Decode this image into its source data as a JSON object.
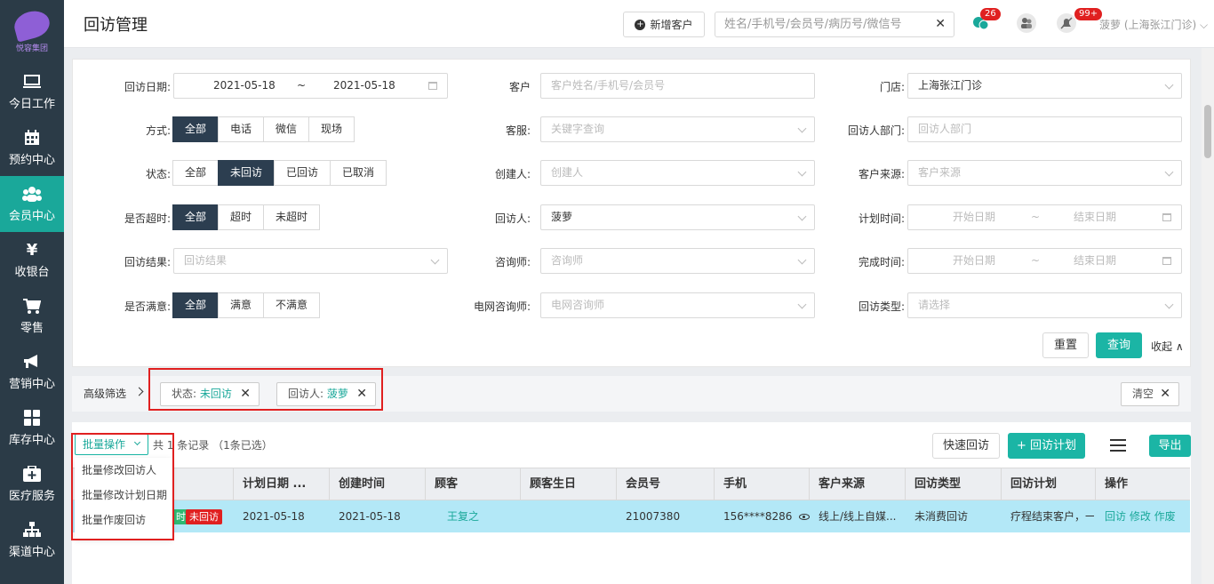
{
  "app": {
    "logo_text": "悦容集团",
    "title": "回访管理"
  },
  "sidebar": {
    "items": [
      {
        "label": "今日工作",
        "icon": "monitor-icon"
      },
      {
        "label": "预约中心",
        "icon": "calendar-icon"
      },
      {
        "label": "会员中心",
        "icon": "members-icon",
        "active": true
      },
      {
        "label": "收银台",
        "icon": "yen-icon"
      },
      {
        "label": "零售",
        "icon": "cart-icon"
      },
      {
        "label": "营销中心",
        "icon": "megaphone-icon"
      },
      {
        "label": "库存中心",
        "icon": "grid-icon"
      },
      {
        "label": "医疗服务",
        "icon": "medical-kit-icon"
      },
      {
        "label": "渠道中心",
        "icon": "org-chart-icon"
      }
    ]
  },
  "topbar": {
    "new_customer": "新增客户",
    "search_placeholder": "姓名/手机号/会员号/病历号/微信号",
    "chat_badge": "26",
    "notify_badge": "99+",
    "user": "菠萝 (上海张江门诊)"
  },
  "filters": {
    "visit_date": {
      "label": "回访日期:",
      "start": "2021-05-18",
      "sep": "~",
      "end": "2021-05-18"
    },
    "customer": {
      "label": "客户",
      "placeholder": "客户姓名/手机号/会员号"
    },
    "store": {
      "label": "门店:",
      "value": "上海张江门诊"
    },
    "method": {
      "label": "方式:",
      "options": [
        "全部",
        "电话",
        "微信",
        "现场"
      ]
    },
    "service": {
      "label": "客服:",
      "placeholder": "关键字查询"
    },
    "dept": {
      "label": "回访人部门:",
      "placeholder": "回访人部门"
    },
    "status": {
      "label": "状态:",
      "options": [
        "全部",
        "未回访",
        "已回访",
        "已取消"
      ]
    },
    "creator": {
      "label": "创建人:",
      "placeholder": "创建人"
    },
    "source": {
      "label": "客户来源:",
      "placeholder": "客户来源"
    },
    "overtime": {
      "label": "是否超时:",
      "options": [
        "全部",
        "超时",
        "未超时"
      ]
    },
    "visitor": {
      "label": "回访人:",
      "value": "菠萝"
    },
    "plan_time": {
      "label": "计划时间:",
      "start": "开始日期",
      "sep": "~",
      "end": "结束日期"
    },
    "result": {
      "label": "回访结果:",
      "placeholder": "回访结果"
    },
    "consultant": {
      "label": "咨询师:",
      "placeholder": "咨询师"
    },
    "done_time": {
      "label": "完成时间:",
      "start": "开始日期",
      "sep": "~",
      "end": "结束日期"
    },
    "satisfied": {
      "label": "是否满意:",
      "options": [
        "全部",
        "满意",
        "不满意"
      ]
    },
    "net_consultant": {
      "label": "电网咨询师:",
      "placeholder": "电网咨询师"
    },
    "visit_type": {
      "label": "回访类型:",
      "placeholder": "请选择"
    },
    "reset": "重置",
    "query": "查询",
    "collapse": "收起"
  },
  "advanced": {
    "label": "高级筛选",
    "tags": [
      {
        "key": "状态: ",
        "value": "未回访"
      },
      {
        "key": "回访人: ",
        "value": "菠萝"
      }
    ],
    "clear": "清空"
  },
  "list": {
    "batch": "批量操作",
    "count": "共 1 条记录 （1条已选）",
    "batch_menu": [
      "批量修改回访人",
      "批量修改计划日期",
      "批量作废回访"
    ],
    "quick_visit": "快速回访",
    "plan": "+ 回访计划",
    "export": "导出",
    "columns": [
      "计划日期 ...",
      "创建时间",
      "顾客",
      "顾客生日",
      "会员号",
      "手机",
      "客户来源",
      "回访类型",
      "回访计划",
      "操作"
    ],
    "rows": [
      {
        "tag_green": "时",
        "tag_red": "未回访",
        "plan_date": "2021-05-18",
        "created": "2021-05-18",
        "customer": "王复之",
        "birthday": "",
        "member_no": "21007380",
        "phone": "156****8286",
        "source": "线上/线上自媒...",
        "type": "未消费回访",
        "plan": "疗程结束客户，一",
        "actions": "回访 修改 作废"
      }
    ]
  },
  "colors": {
    "accent": "#1bb5a5",
    "sidebar": "#2b3b47",
    "active_segment": "#2c3e50",
    "highlight_row": "#b3e8f7",
    "alert": "#e02020"
  }
}
